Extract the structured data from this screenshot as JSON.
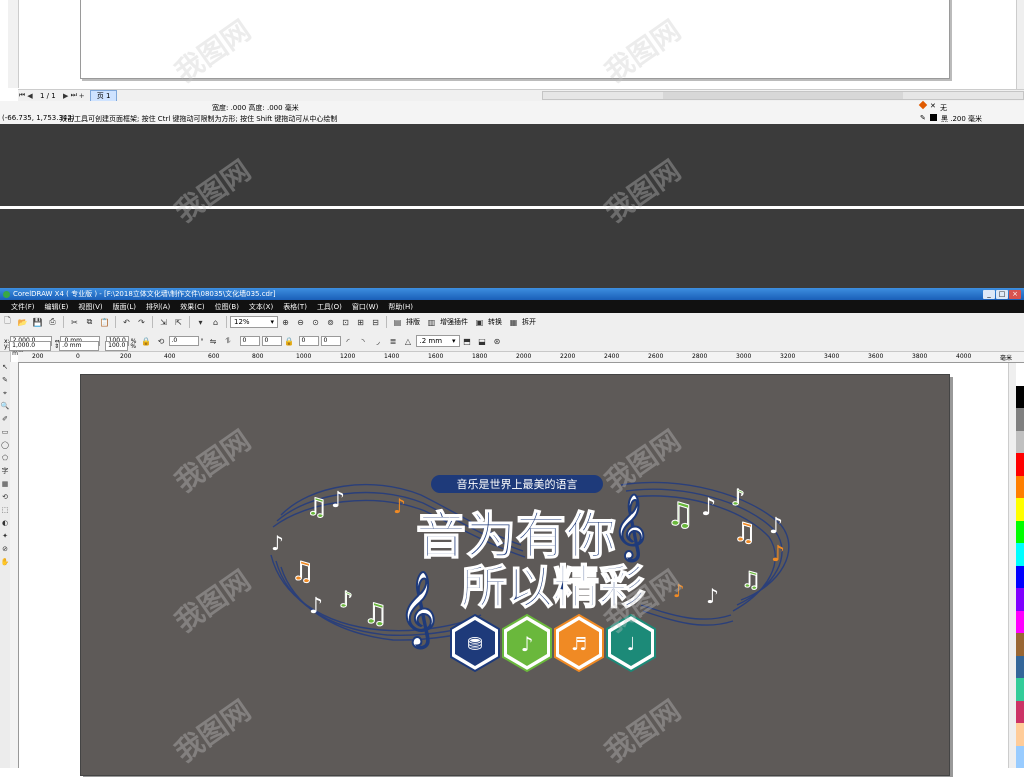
{
  "prev_window": {
    "page_indicator": "1 / 1",
    "page_tab": "页 1",
    "status_size": "宽度: .000  高度: .000  毫米",
    "status_coords": "(-66.735, 1,753.342)",
    "status_hint": "双击工具可创建页面框架; 按住 Ctrl 键拖动可限制为方形; 按住 Shift 键拖动可从中心绘制",
    "fill_label": "无",
    "outline_label": "黑  .200 毫米"
  },
  "window": {
    "title": "CorelDRAW X4 ( 专业版 ) - [F:\\2018立体文化墙\\制作文件\\08035\\文化墙035.cdr]",
    "controls": [
      "_",
      "□",
      "×"
    ]
  },
  "menu": [
    "文件(F)",
    "编辑(E)",
    "视图(V)",
    "版面(L)",
    "排列(A)",
    "效果(C)",
    "位图(B)",
    "文本(X)",
    "表格(T)",
    "工具(O)",
    "窗口(W)",
    "帮助(H)"
  ],
  "toolbar": {
    "zoom": "12%",
    "btn_arrange": "排版",
    "btn_plugin": "增强插件",
    "btn_convert": "转换",
    "btn_split": "拆开"
  },
  "property_bar": {
    "x": "2,000.0 mm",
    "y": "1,000.0 mm",
    "w": ".0 mm",
    "h": ".0 mm",
    "scale_w": "100.0",
    "scale_h": "100.0",
    "pct": "%",
    "rotation": ".0",
    "deg": "°",
    "v1": "0",
    "v2": "0",
    "v3": "0",
    "v4": "0",
    "outline": ".2 mm"
  },
  "ruler_ticks": [
    "200",
    "0",
    "200",
    "400",
    "600",
    "800",
    "1000",
    "1200",
    "1400",
    "1600",
    "1800",
    "2000",
    "2200",
    "2400",
    "2600",
    "2800",
    "3000",
    "3200",
    "3400",
    "3600",
    "3800",
    "4000",
    "毫米"
  ],
  "tools": [
    "↖",
    "✎",
    "⌖",
    "🔍",
    "✐",
    "▭",
    "◯",
    "⬠",
    "字",
    "▦",
    "⟲",
    "⬚",
    "◐",
    "✦",
    "⊘",
    "✋"
  ],
  "artwork": {
    "slogan": "音乐是世界上最美的语言",
    "headline_line1": "音为有你",
    "headline_line2": "所以精彩",
    "icons": [
      "drum-set",
      "guitar",
      "piano",
      "trumpet"
    ]
  },
  "colors": {
    "page_bg": "#5e5a58",
    "navy": "#1e3a7a",
    "green": "#6ab83c",
    "orange": "#f08a24",
    "teal": "#1c8a78"
  },
  "palette": [
    "#ffffff",
    "#000000",
    "#7f7f7f",
    "#c0c0c0",
    "#ff0000",
    "#ff7f00",
    "#ffff00",
    "#00ff00",
    "#00ffff",
    "#0000ff",
    "#8000ff",
    "#ff00ff",
    "#996633",
    "#336699",
    "#33cc99",
    "#cc3366",
    "#ffcc99",
    "#99ccff"
  ],
  "watermark": "我图网"
}
